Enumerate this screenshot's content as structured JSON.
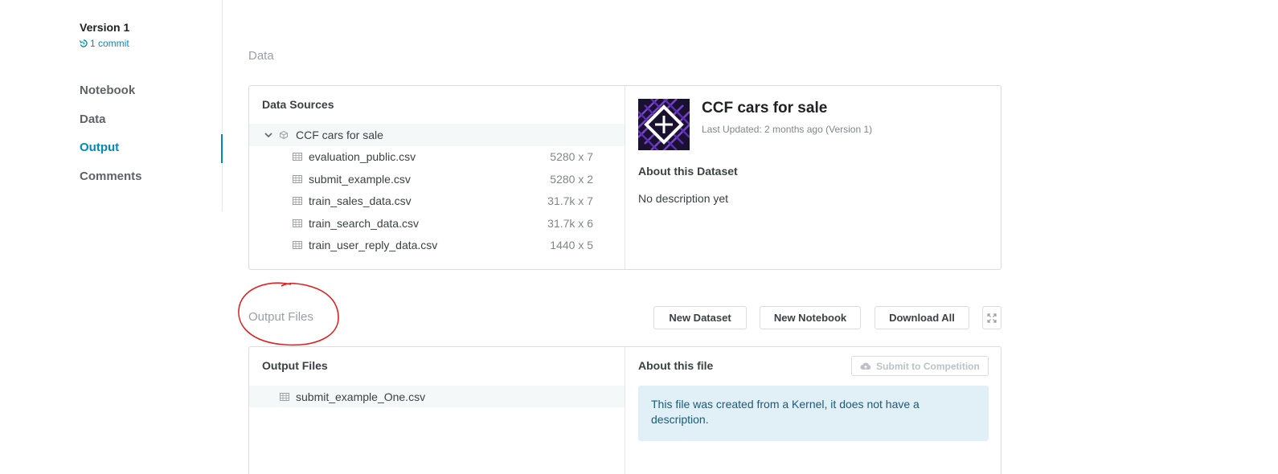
{
  "version": {
    "title": "Version 1",
    "commit": "1 commit"
  },
  "nav": {
    "items": [
      {
        "label": "Notebook"
      },
      {
        "label": "Data"
      },
      {
        "label": "Output"
      },
      {
        "label": "Comments"
      }
    ],
    "active": "Output"
  },
  "data_section": {
    "title": "Data",
    "sources_heading": "Data Sources",
    "dataset_name": "CCF cars for sale",
    "files": [
      {
        "name": "evaluation_public.csv",
        "size": "5280 x 7"
      },
      {
        "name": "submit_example.csv",
        "size": "5280 x 2"
      },
      {
        "name": "train_sales_data.csv",
        "size": "31.7k x 7"
      },
      {
        "name": "train_search_data.csv",
        "size": "31.7k x 6"
      },
      {
        "name": "train_user_reply_data.csv",
        "size": "1440 x 5"
      }
    ],
    "detail": {
      "title": "CCF cars for sale",
      "last_updated": "Last Updated: 2 months ago (Version 1)",
      "about_heading": "About this Dataset",
      "description": "No description yet"
    }
  },
  "output_section": {
    "title": "Output Files",
    "buttons": {
      "new_dataset": "New Dataset",
      "new_notebook": "New Notebook",
      "download_all": "Download All"
    },
    "files_heading": "Output Files",
    "file": "submit_example_One.csv",
    "about_heading": "About this file",
    "submit_label": "Submit to Competition",
    "info": "This file was created from a Kernel, it does not have a description."
  },
  "colors": {
    "accent": "#008abc",
    "annotation": "#e02020"
  },
  "icons": [
    "history-icon",
    "chevron-down-icon",
    "dataset-icon",
    "table-icon",
    "expand-icon",
    "cloud-upload-icon"
  ]
}
